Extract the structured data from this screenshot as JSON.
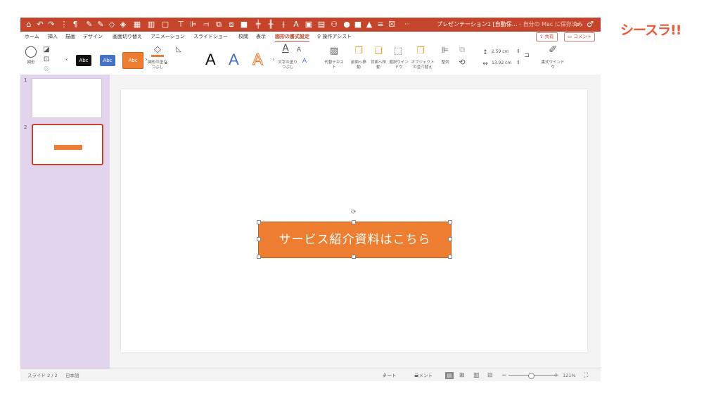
{
  "brand": {
    "logo_text": "シースラ!!",
    "color": "#ea5a36"
  },
  "titlebar": {
    "title": "プレゼンテーション1 [自動保…",
    "subtitle": "- 自分の Mac に保存済み",
    "more": "···",
    "search_icon": "search-icon",
    "accent_color": "#c4452b"
  },
  "menu": {
    "tabs": [
      "ホーム",
      "挿入",
      "描画",
      "デザイン",
      "画面切り替え",
      "アニメーション",
      "スライドショー",
      "校閲",
      "表示",
      "図形の書式設定"
    ],
    "active_tab": "図形の書式設定",
    "assist": "操作アシスト",
    "share": "共有",
    "comment": "コメント"
  },
  "ribbon": {
    "shape_label": "図形",
    "styles": [
      "Abc",
      "Abc",
      "Abc"
    ],
    "fill_label": "図形の塗りつぶし",
    "wordart": [
      "A",
      "A",
      "A"
    ],
    "text_fill_label": "文字の塗りつぶし",
    "alt_text_label": "代替テキスト",
    "bring_forward": "前面へ移動",
    "send_backward": "背面へ移動",
    "selection_pane": "選択ウインドウ",
    "reorder": "オブジェクトの並べ替え",
    "align": "整列",
    "height": "2.59 cm",
    "width": "13.92 cm",
    "format_pane": "書式ウインドウ"
  },
  "slides": {
    "numbers": [
      "1",
      "2"
    ],
    "selected": "2"
  },
  "slide": {
    "shape_text": "サービス紹介資料はこちら",
    "shape_color": "#ed7d31"
  },
  "status": {
    "slide_pos": "スライド 2 / 2",
    "language": "日本語",
    "notes": "ノート",
    "comments": "コメント",
    "zoom": "121%"
  }
}
